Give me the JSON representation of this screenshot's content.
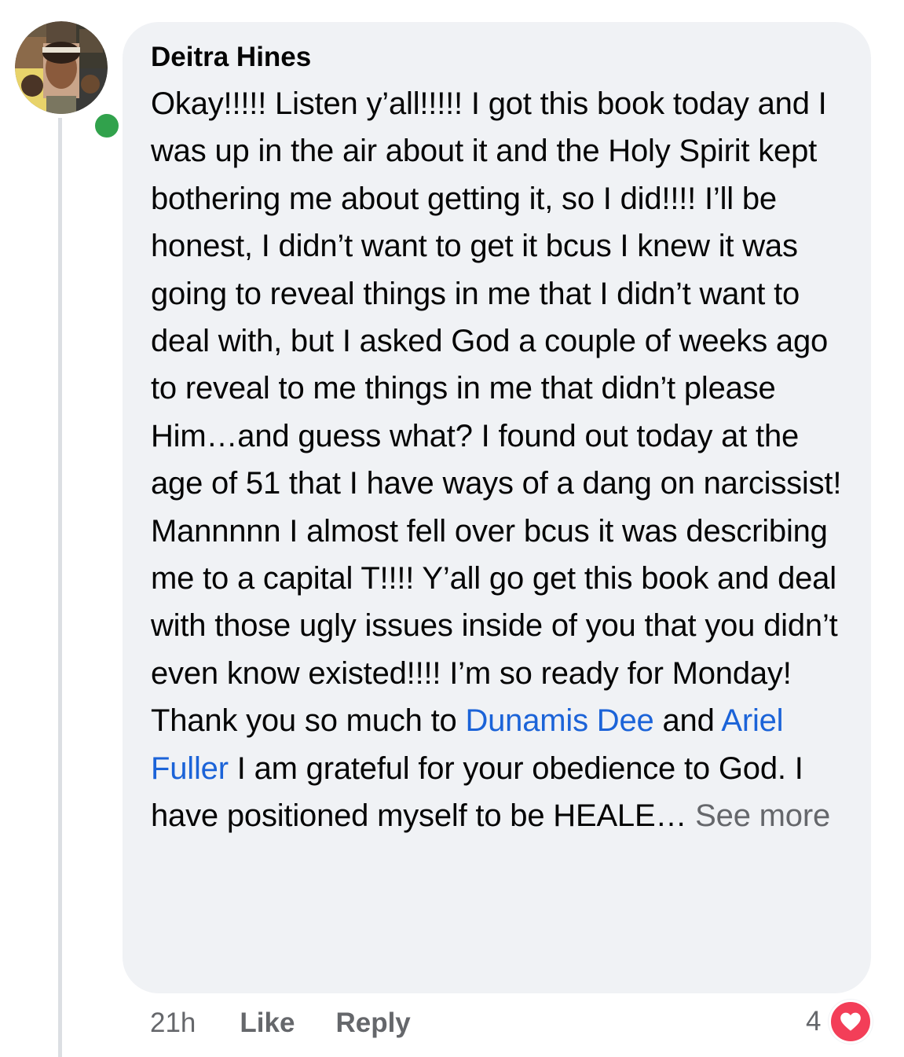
{
  "comment": {
    "author": "Deitra Hines",
    "body_segments": [
      "Okay!!!!! Listen y’all!!!!! I got this book today and I was up in the air about it and the Holy Spirit kept bothering me about getting it, so I did!!!! I’ll be honest, I didn’t want to get it bcus I knew it was going to reveal things in me that I didn’t want to deal with, but I asked God a couple of weeks ago to reveal to me things in me that didn’t please Him…and guess what? I found out today at the age of 51 that I have ways of a dang on narcissist! Mannnnn I almost fell over bcus it was describing me to a capital T!!!! Y’all go get this book and deal with those ugly issues inside of you that you didn’t even know existed!!!! I’m so ready for Monday! Thank you so much to ",
      " and ",
      " I am grateful for your obedience to God. I have positioned myself to be HEALE… "
    ],
    "mentions": [
      "Dunamis Dee",
      "Ariel Fuller"
    ],
    "see_more_label": "See more",
    "timestamp": "21h",
    "like_label": "Like",
    "reply_label": "Reply",
    "reaction_count": "4",
    "reaction_type": "heart-icon",
    "online_status_color": "#31a24c",
    "mention_color": "#1b63d8",
    "reaction_color": "#f33e58"
  }
}
